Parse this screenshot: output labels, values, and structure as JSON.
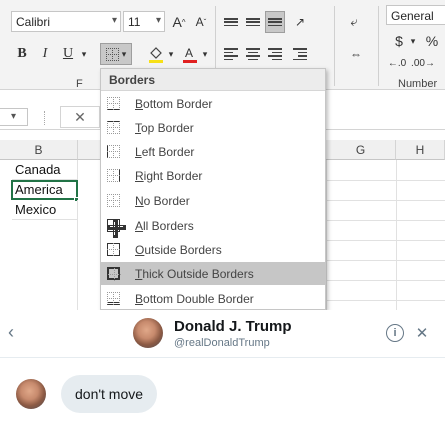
{
  "ribbon": {
    "font_name": "Calibri",
    "font_size": "11",
    "grow_font": "A",
    "shrink_font": "A",
    "bold": "B",
    "italic": "I",
    "underline": "U",
    "font_group_label": "F",
    "number_format": "General",
    "currency_symbol": "$",
    "percent_symbol": "%",
    "number_group_label": "Number",
    "font_color_accent": "#e02020",
    "fill_color_accent": "#f7e017"
  },
  "formula_bar": {
    "fx": "✕"
  },
  "sheet": {
    "columns": [
      {
        "label": "B"
      },
      {
        "label": "G"
      },
      {
        "label": "H"
      }
    ],
    "cells": [
      "Canada",
      "America",
      "Mexico"
    ],
    "active_color": "#217346"
  },
  "borders_menu": {
    "title": "Borders",
    "items": [
      {
        "label": "Bottom Border",
        "icon": "bottom-border-icon"
      },
      {
        "label": "Top Border",
        "icon": "top-border-icon"
      },
      {
        "label": "Left Border",
        "icon": "left-border-icon"
      },
      {
        "label": "Right Border",
        "icon": "right-border-icon"
      },
      {
        "label": "No Border",
        "icon": "no-border-icon"
      },
      {
        "label": "All Borders",
        "icon": "all-borders-icon"
      },
      {
        "label": "Outside Borders",
        "icon": "outside-borders-icon"
      },
      {
        "label": "Thick Outside Borders",
        "icon": "thick-outside-borders-icon"
      },
      {
        "label": "Bottom Double Border",
        "icon": "bottom-double-border-icon"
      }
    ],
    "highlighted": "Thick Outside Borders"
  },
  "dm": {
    "name": "Donald J. Trump",
    "handle": "@realDonaldTrump",
    "message": "don't move",
    "bubble_color": "#e6ecf0"
  }
}
